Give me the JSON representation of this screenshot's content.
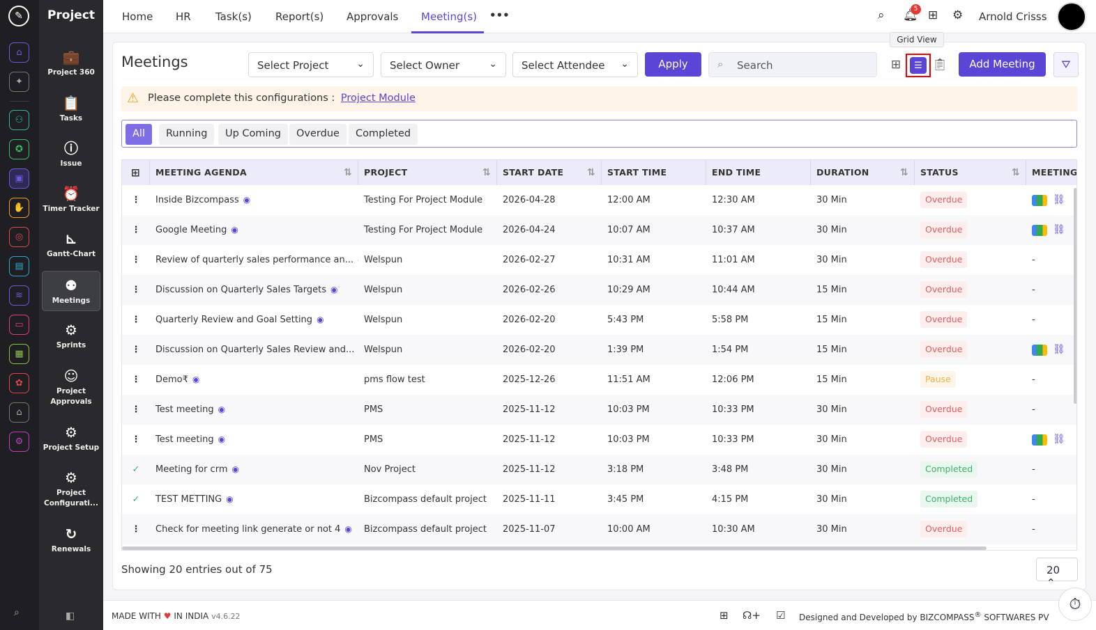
{
  "app": {
    "section_title": "Project"
  },
  "colors": {
    "accent": "#5b45d6",
    "overdue": "#e35d5d",
    "completed": "#3bb26b",
    "pause": "#f0b24a",
    "warning": "#f2a21b"
  },
  "rail_icons": [
    "home-icon",
    "pin-icon",
    "users-icon",
    "bug-icon",
    "briefcase-icon",
    "hand-icon",
    "target-icon",
    "box-icon",
    "layers-icon",
    "monitor-icon",
    "document-icon",
    "award-icon",
    "house-icon",
    "settings-icon"
  ],
  "sidebar": {
    "items": [
      {
        "label": "Project 360",
        "icon": "briefcase-icon"
      },
      {
        "label": "Tasks",
        "icon": "clipboard-icon"
      },
      {
        "label": "Issue",
        "icon": "alert-icon"
      },
      {
        "label": "Timer Tracker",
        "icon": "alarm-icon"
      },
      {
        "label": "Gantt-Chart",
        "icon": "chart-icon"
      },
      {
        "label": "Meetings",
        "icon": "meeting-icon"
      },
      {
        "label": "Sprints",
        "icon": "gear-icon"
      },
      {
        "label": "Project Approvals",
        "icon": "user-check-icon"
      },
      {
        "label": "Project Setup",
        "icon": "gear-icon"
      },
      {
        "label": "Project Configurati...",
        "icon": "gear-icon"
      },
      {
        "label": "Renewals",
        "icon": "refresh-icon"
      }
    ]
  },
  "topnav": {
    "items": [
      "Home",
      "HR",
      "Task(s)",
      "Report(s)",
      "Approvals",
      "Meeting(s)"
    ],
    "more": "•••",
    "notification_count": "5",
    "user_name": "Arnold Crisss"
  },
  "page": {
    "title": "Meetings",
    "select_project": "Select Project",
    "select_owner": "Select Owner",
    "select_attendee": "Select Attendee",
    "apply": "Apply",
    "search_placeholder": "Search",
    "tooltip": "Grid View",
    "add_meeting": "Add Meeting",
    "warning_text": "Please complete this configurations :",
    "warning_link": "Project Module"
  },
  "tabs": [
    "All",
    "Running",
    "Up Coming",
    "Overdue",
    "Completed"
  ],
  "table": {
    "headers": [
      "MEETING AGENDA",
      "PROJECT",
      "START DATE",
      "START TIME",
      "END TIME",
      "DURATION",
      "STATUS",
      "MEETING"
    ],
    "rows": [
      {
        "agenda": "Inside Bizcompass",
        "project": "Testing For Project Module",
        "start_date": "2026-04-28",
        "start_time": "12:00 AM",
        "end_time": "12:30 AM",
        "duration": "30 Min",
        "status": "Overdue",
        "meeting": "link",
        "action": "menu"
      },
      {
        "agenda": "Google Meeting",
        "project": "Testing For Project Module",
        "start_date": "2026-04-24",
        "start_time": "10:07 AM",
        "end_time": "10:37 AM",
        "duration": "30 Min",
        "status": "Overdue",
        "meeting": "link",
        "action": "menu"
      },
      {
        "agenda": "Review of quarterly sales performance an...",
        "project": "Welspun",
        "start_date": "2026-02-27",
        "start_time": "10:31 AM",
        "end_time": "11:01 AM",
        "duration": "30 Min",
        "status": "Overdue",
        "meeting": "-",
        "action": "menu"
      },
      {
        "agenda": "Discussion on Quarterly Sales Targets",
        "project": "Welspun",
        "start_date": "2026-02-26",
        "start_time": "10:29 AM",
        "end_time": "10:44 AM",
        "duration": "15 Min",
        "status": "Overdue",
        "meeting": "-",
        "action": "menu"
      },
      {
        "agenda": "Quarterly Review and Goal Setting",
        "project": "Welspun",
        "start_date": "2026-02-20",
        "start_time": "5:43 PM",
        "end_time": "5:58 PM",
        "duration": "15 Min",
        "status": "Overdue",
        "meeting": "-",
        "action": "menu"
      },
      {
        "agenda": "Discussion on Quarterly Sales Review and...",
        "project": "Welspun",
        "start_date": "2026-02-20",
        "start_time": "1:39 PM",
        "end_time": "1:54 PM",
        "duration": "15 Min",
        "status": "Overdue",
        "meeting": "link",
        "action": "menu"
      },
      {
        "agenda": "Demo₹",
        "project": "pms flow test",
        "start_date": "2025-12-26",
        "start_time": "11:51 AM",
        "end_time": "12:06 PM",
        "duration": "15 Min",
        "status": "Pause",
        "meeting": "-",
        "action": "menu"
      },
      {
        "agenda": "Test meeting",
        "project": "PMS",
        "start_date": "2025-11-12",
        "start_time": "10:03 PM",
        "end_time": "10:33 PM",
        "duration": "30 Min",
        "status": "Overdue",
        "meeting": "-",
        "action": "menu"
      },
      {
        "agenda": "Test meeting",
        "project": "PMS",
        "start_date": "2025-11-12",
        "start_time": "10:03 PM",
        "end_time": "10:33 PM",
        "duration": "30 Min",
        "status": "Overdue",
        "meeting": "link",
        "action": "menu"
      },
      {
        "agenda": "Meeting for crm",
        "project": "Nov Project",
        "start_date": "2025-11-12",
        "start_time": "3:18 PM",
        "end_time": "3:48 PM",
        "duration": "30 Min",
        "status": "Completed",
        "meeting": "-",
        "action": "check"
      },
      {
        "agenda": "TEST METTING",
        "project": "Bizcompass default project",
        "start_date": "2025-11-11",
        "start_time": "3:45 PM",
        "end_time": "4:15 PM",
        "duration": "30 Min",
        "status": "Completed",
        "meeting": "-",
        "action": "check"
      },
      {
        "agenda": "Check for meeting link generate or not 4",
        "project": "Bizcompass default project",
        "start_date": "2025-11-07",
        "start_time": "10:00 AM",
        "end_time": "10:30 AM",
        "duration": "30 Min",
        "status": "Overdue",
        "meeting": "-",
        "action": "menu"
      }
    ]
  },
  "pagination": {
    "showing": "Showing 20 entries out of 75",
    "page_size": "20"
  },
  "footer": {
    "made_with": "MADE WITH",
    "in_india": "IN INDIA",
    "version": "v4.6.22",
    "designed": "Designed and Developed by",
    "brand": "BIZCOMPASS",
    "reg": "®",
    "softwares": "SOFTWARES PV"
  }
}
